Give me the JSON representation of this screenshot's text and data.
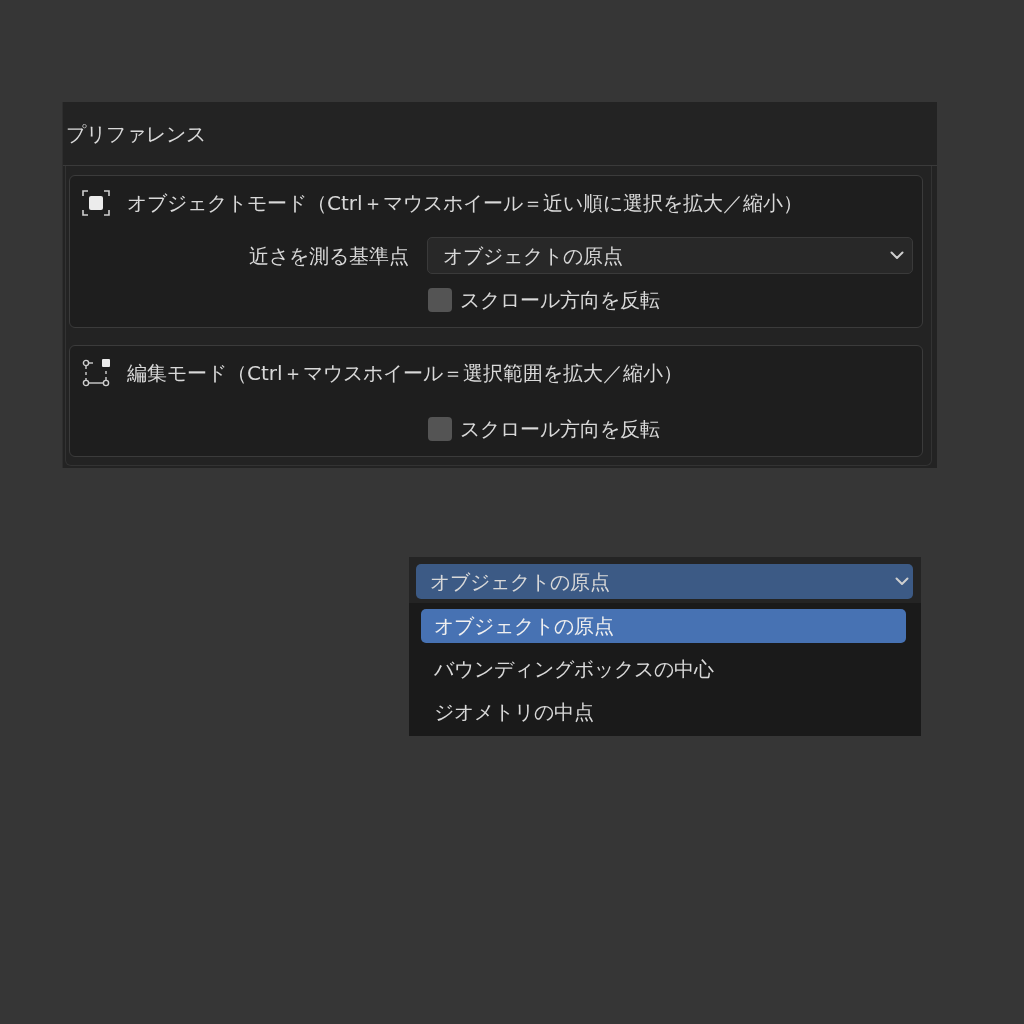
{
  "window": {
    "title": "プリファレンス"
  },
  "sections": [
    {
      "title": "オブジェクトモード（Ctrl＋マウスホイール＝近い順に選択を拡大／縮小）",
      "fields": [
        {
          "kind": "dropdown",
          "label": "近さを測る基準点",
          "value": "オブジェクトの原点"
        },
        {
          "kind": "checkbox",
          "label": "スクロール方向を反転",
          "checked": false
        }
      ]
    },
    {
      "title": "編集モード（Ctrl＋マウスホイール＝選択範囲を拡大／縮小）",
      "fields": [
        {
          "kind": "checkbox",
          "label": "スクロール方向を反転",
          "checked": false
        }
      ]
    }
  ],
  "dropdown_menu": {
    "value": "オブジェクトの原点",
    "options": [
      {
        "label": "オブジェクトの原点",
        "selected": true
      },
      {
        "label": "バウンディングボックスの中心",
        "selected": false
      },
      {
        "label": "ジオメトリの中点",
        "selected": false
      }
    ]
  }
}
